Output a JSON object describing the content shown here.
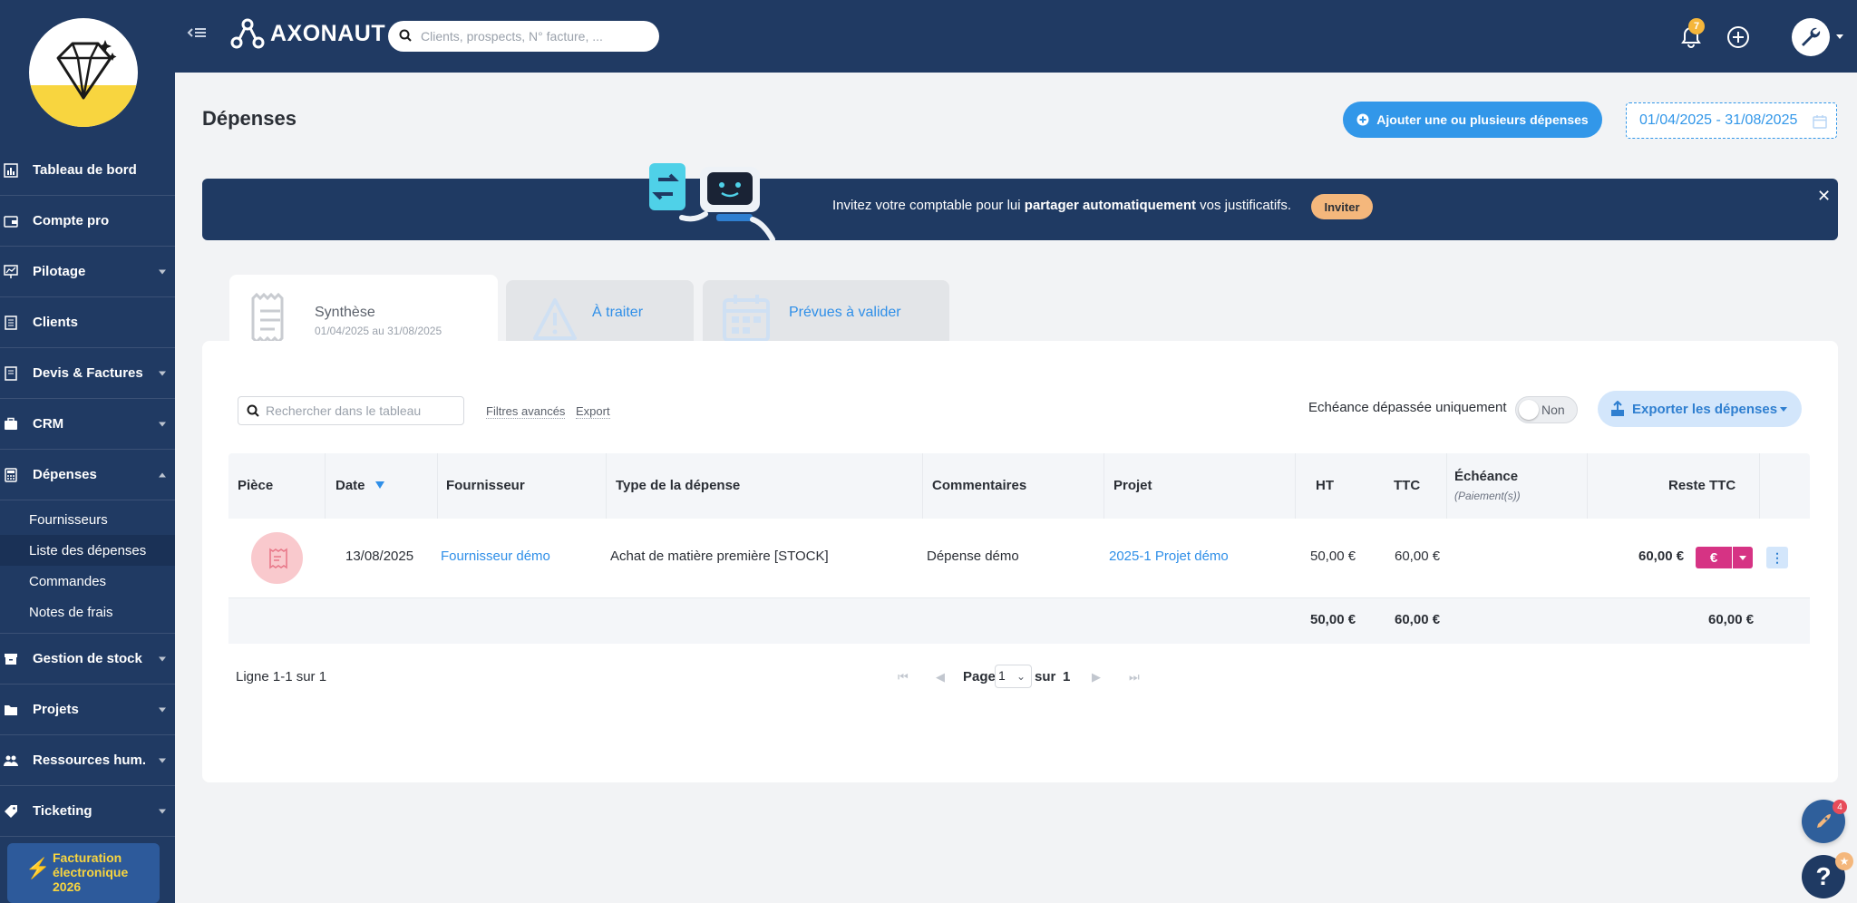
{
  "app": {
    "brand": "AXONAUT",
    "search_placeholder": "Clients, prospects, N° facture, ...",
    "notifications_count": "7"
  },
  "sidebar": {
    "items": [
      {
        "label": "Tableau de bord",
        "icon": "dashboard-icon"
      },
      {
        "label": "Compte pro",
        "icon": "wallet-icon"
      },
      {
        "label": "Pilotage",
        "icon": "chart-icon"
      },
      {
        "label": "Clients",
        "icon": "clients-icon"
      },
      {
        "label": "Devis & Factures",
        "icon": "invoice-icon"
      },
      {
        "label": "CRM",
        "icon": "briefcase-icon"
      },
      {
        "label": "Dépenses",
        "icon": "calculator-icon"
      },
      {
        "label": "Gestion de stock",
        "icon": "box-icon"
      },
      {
        "label": "Projets",
        "icon": "folder-icon"
      },
      {
        "label": "Ressources hum.",
        "icon": "people-icon"
      },
      {
        "label": "Ticketing",
        "icon": "tag-icon"
      }
    ],
    "depenses_sub": [
      "Fournisseurs",
      "Liste des dépenses",
      "Commandes",
      "Notes de frais"
    ],
    "einvoice": [
      "Facturation",
      "électronique",
      "2026"
    ]
  },
  "page": {
    "title": "Dépenses",
    "add_button": "Ajouter une ou plusieurs dépenses",
    "date_range": "01/04/2025 - 31/08/2025"
  },
  "banner": {
    "text_before": "Invitez votre comptable pour lui ",
    "text_bold": "partager automatiquement",
    "text_after": " vos justificatifs.",
    "invite_label": "Inviter"
  },
  "tabs": [
    {
      "title": "Synthèse",
      "subtitle": "01/04/2025 au 31/08/2025"
    },
    {
      "title": "À traiter"
    },
    {
      "title": "Prévues à valider"
    }
  ],
  "toolbar": {
    "search_placeholder": "Rechercher dans le tableau",
    "advanced_filters": "Filtres avancés",
    "export_link": "Export",
    "overdue_label": "Echéance dépassée uniquement",
    "toggle_value": "Non",
    "export_button": "Exporter les dépenses"
  },
  "table": {
    "headers": {
      "piece": "Pièce",
      "date": "Date",
      "supplier": "Fournisseur",
      "type": "Type de la dépense",
      "comments": "Commentaires",
      "project": "Projet",
      "ht": "HT",
      "ttc": "TTC",
      "due": "Échéance",
      "due_sub": "(Paiement(s))",
      "remaining": "Reste TTC"
    },
    "rows": [
      {
        "date": "13/08/2025",
        "supplier": "Fournisseur démo",
        "type": "Achat de matière première [STOCK]",
        "comments": "Dépense démo",
        "project": "2025-1 Projet démo",
        "ht": "50,00 €",
        "ttc": "60,00 €",
        "remaining": "60,00 €",
        "pay_symbol": "€"
      }
    ],
    "totals": {
      "ht": "50,00 €",
      "ttc": "60,00 €",
      "remaining": "60,00 €"
    }
  },
  "pagination": {
    "summary": "Ligne 1-1 sur 1",
    "page_label": "Page",
    "current": "1",
    "of_label": "sur",
    "total": "1"
  },
  "floating": {
    "help_badge": "4",
    "question": "?"
  },
  "colors": {
    "navy": "#203a63",
    "accent": "#3297e9",
    "pink": "#d63384",
    "yellow": "#f8d53f"
  }
}
